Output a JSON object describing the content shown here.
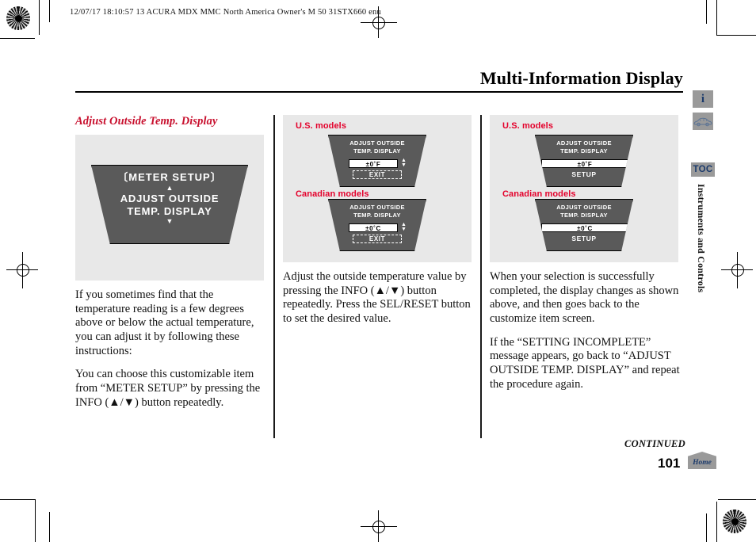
{
  "print_slug": "12/07/17 18:10:57   13 ACURA MDX MMC North America Owner's M 50 31STX660 enu",
  "header": {
    "title": "Multi-Information Display"
  },
  "columns": {
    "left": {
      "section_head": "Adjust Outside Temp. Display",
      "illustration": {
        "meter": {
          "title": "〔METER SETUP〕",
          "up_arrow": "▲",
          "line1": "ADJUST OUTSIDE",
          "line2": "TEMP. DISPLAY",
          "down_arrow": "▼"
        }
      },
      "paragraph_1": "If you sometimes find that the temperature reading is a few degrees above or below the actual temperature, you can adjust it by following these instructions:",
      "paragraph_2": "You can choose this customizable item from “METER SETUP” by pressing the INFO (▲/▼) button repeatedly."
    },
    "middle": {
      "illustration": {
        "us_label": "U.S. models",
        "canadian_label": "Canadian models",
        "us_meter": {
          "title_line1": "ADJUST OUTSIDE",
          "title_line2": "TEMP. DISPLAY",
          "value": "±0˚F",
          "spinner": "▲▼",
          "exit": "EXIT"
        },
        "canadian_meter": {
          "title_line1": "ADJUST OUTSIDE",
          "title_line2": "TEMP. DISPLAY",
          "value": "±0˚C",
          "spinner": "▲▼",
          "exit": "EXIT"
        }
      },
      "paragraph_1": "Adjust the outside temperature value by pressing the INFO (▲/▼) button repeatedly. Press the SEL/RESET button to set the desired value."
    },
    "right": {
      "illustration": {
        "us_label": "U.S. models",
        "canadian_label": "Canadian models",
        "us_meter": {
          "title_line1": "ADJUST OUTSIDE",
          "title_line2": "TEMP. DISPLAY",
          "value": "±0˚F",
          "setup": "SETUP"
        },
        "canadian_meter": {
          "title_line1": "ADJUST OUTSIDE",
          "title_line2": "TEMP. DISPLAY",
          "value": "±0˚C",
          "setup": "SETUP"
        }
      },
      "paragraph_1": "When your selection is successfully completed, the display changes as shown above, and then goes back to the customize item screen.",
      "paragraph_2": "If the “SETTING INCOMPLETE” message appears, go back to “ADJUST OUTSIDE TEMP. DISPLAY” and repeat the procedure again."
    }
  },
  "side_tabs": {
    "info_icon": "i",
    "toc_label": "TOC",
    "section_name": "Instruments and Controls"
  },
  "footer": {
    "continued": "CONTINUED",
    "page_number": "101",
    "home_label": "Home"
  },
  "colors": {
    "accent_red": "#c8102e",
    "label_red": "#e4002b",
    "badge_blue": "#1b3a6b",
    "panel_gray": "#e8e8e8",
    "meter_gray": "#5a5a5a"
  }
}
